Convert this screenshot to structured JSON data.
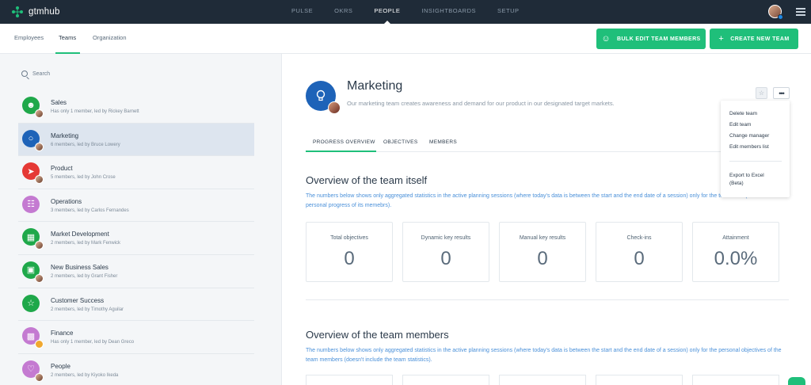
{
  "app": {
    "brand": "gtmhub"
  },
  "topnav": [
    {
      "label": "PULSE",
      "active": false
    },
    {
      "label": "OKRS",
      "active": false
    },
    {
      "label": "PEOPLE",
      "active": true
    },
    {
      "label": "INSIGHTBOARDS",
      "active": false
    },
    {
      "label": "SETUP",
      "active": false
    }
  ],
  "subtabs": [
    {
      "label": "Employees",
      "active": false
    },
    {
      "label": "Teams",
      "active": true
    },
    {
      "label": "Organization",
      "active": false
    }
  ],
  "actions": {
    "bulk_edit": "BULK EDIT TEAM MEMBERS",
    "create_team": "CREATE NEW TEAM"
  },
  "colors": {
    "accent": "#1fbf7a",
    "topbar": "#1f2b38",
    "link_text": "#4a90d9"
  },
  "sidebar": {
    "search_placeholder": "Search",
    "teams": [
      {
        "name": "Sales",
        "meta": "Has only 1 member, led by Rickey Barnett",
        "color": "#1fa84a",
        "icon": "people-icon"
      },
      {
        "name": "Marketing",
        "meta": "6 members, led by Bruce Lowery",
        "color": "#1e63b8",
        "icon": "lightbulb-icon",
        "active": true
      },
      {
        "name": "Product",
        "meta": "5 members, led by John Crose",
        "color": "#e53935",
        "icon": "rocket-icon"
      },
      {
        "name": "Operations",
        "meta": "3 members, led by Carlos Fernandes",
        "color": "#c47ad1",
        "icon": "org-chart-icon"
      },
      {
        "name": "Market Development",
        "meta": "2 members, led by Mark Fenwick",
        "color": "#1fa84a",
        "icon": "building-icon"
      },
      {
        "name": "New Business Sales",
        "meta": "2 members, led by Grant Fisher",
        "color": "#1fa84a",
        "icon": "presentation-icon"
      },
      {
        "name": "Customer Success",
        "meta": "2 members, led by Timothy Aguilar",
        "color": "#1fa84a",
        "icon": "star-icon"
      },
      {
        "name": "Finance",
        "meta": "Has only 1 member, led by Dean Greco",
        "color": "#c47ad1",
        "icon": "money-icon"
      },
      {
        "name": "People",
        "meta": "2 members, led by Kiyoko Ikeda",
        "color": "#c47ad1",
        "icon": "heart-icon"
      }
    ]
  },
  "team": {
    "title": "Marketing",
    "description": "Our marketing team creates awareness and demand for our product in our designated target markets."
  },
  "menu": {
    "items": [
      "Delete team",
      "Edit team",
      "Change manager",
      "Edit members list"
    ],
    "export_line1": "Export to Excel",
    "export_line2": "(Beta)"
  },
  "profile_tabs": [
    {
      "label": "PROGRESS OVERVIEW",
      "active": true
    },
    {
      "label": "OBJECTIVES",
      "active": false
    },
    {
      "label": "MEMBERS",
      "active": false
    }
  ],
  "overview_team": {
    "title": "Overview of the team itself",
    "description": "The numbers below shows only aggregated statistics in the active planning sessions (where today's data is between the start and the end date of a session) only for the team itself (doesn't include personal progress of its memebrs).",
    "stats": [
      {
        "label": "Total objectives",
        "value": "0"
      },
      {
        "label": "Dynamic key results",
        "value": "0"
      },
      {
        "label": "Manual key results",
        "value": "0"
      },
      {
        "label": "Check-ins",
        "value": "0"
      },
      {
        "label": "Attainment",
        "value": "0.0%"
      }
    ]
  },
  "overview_members": {
    "title": "Overview of the team members",
    "description": "The numbers below shows only aggregated statistics in the active planning sessions (where today's data is between the start and the end date of a session) only for the personal objectives of the team members (doesn't include the team statistics)."
  }
}
